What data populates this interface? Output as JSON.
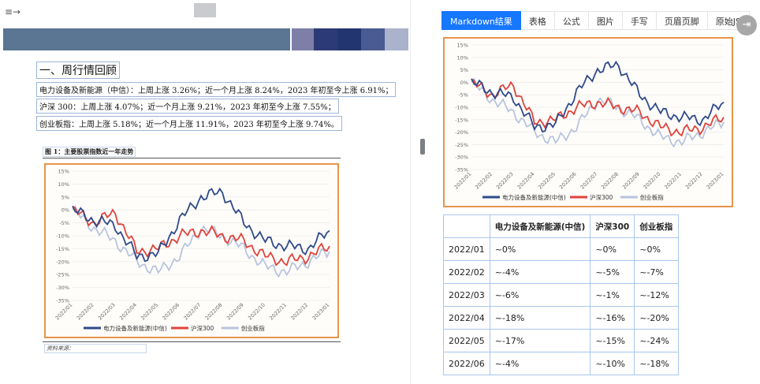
{
  "toolbar": {
    "sidebar_toggle_glyph": "≡→"
  },
  "document": {
    "heading": "一、周行情回顾",
    "lines": [
      "电力设备及新能源（中信）：上周上涨 3.26%；近一个月上涨 8.24%，2023 年初至今上涨 6.91%；",
      "沪深 300：上周上涨 4.07%；近一个月上涨 9.21%，2023 年初至今上涨 7.55%；",
      "创业板指：上周上涨 5.18%；近一个月上涨 11.91%，2023 年初至今上涨 9.74%。"
    ],
    "figure_label": "图 1：主要股票指数近一年走势",
    "source_label": "资料来源："
  },
  "tabs": [
    {
      "label": "Markdown结果",
      "active": true
    },
    {
      "label": "表格",
      "active": false
    },
    {
      "label": "公式",
      "active": false
    },
    {
      "label": "图片",
      "active": false
    },
    {
      "label": "手写",
      "active": false
    },
    {
      "label": "页眉页脚",
      "active": false
    },
    {
      "label": "原始JS",
      "active": false
    }
  ],
  "exit_icon": "exit-icon",
  "chart_data": {
    "type": "line",
    "title": "",
    "xlabel": "",
    "ylabel": "",
    "categories": [
      "2022/01",
      "2022/02",
      "2022/03",
      "2022/04",
      "2022/05",
      "2022/06",
      "2022/07",
      "2022/08",
      "2022/09",
      "2022/10",
      "2022/11",
      "2022/12",
      "2023/01"
    ],
    "ylim": [
      -35,
      15
    ],
    "yticks": [
      "15%",
      "10%",
      "5%",
      "0%",
      "-5%",
      "-10%",
      "-15%",
      "-20%",
      "-25%",
      "-30%",
      "-35%"
    ],
    "legend_position": "bottom",
    "series": [
      {
        "name": "电力设备及新能源(中信)",
        "color": "#2f4a8a",
        "values": [
          0,
          -4,
          -6,
          -18,
          -17,
          -4,
          5,
          7,
          -5,
          -12,
          -14,
          -15,
          -8
        ]
      },
      {
        "name": "沪深300",
        "color": "#e0433b",
        "values": [
          0,
          -5,
          -1,
          -16,
          -15,
          -10,
          -8,
          -10,
          -12,
          -18,
          -20,
          -18,
          -14
        ]
      },
      {
        "name": "创业板指",
        "color": "#b8c4de",
        "values": [
          0,
          -7,
          -12,
          -20,
          -24,
          -18,
          -7,
          -10,
          -15,
          -22,
          -24,
          -20,
          -16
        ]
      }
    ]
  },
  "table": {
    "headers": [
      "",
      "电力设备及新能源(中信)",
      "沪深300",
      "创业板指"
    ],
    "rows": [
      [
        "2022/01",
        "~0%",
        "~0%",
        "~0%"
      ],
      [
        "2022/02",
        "~-4%",
        "~-5%",
        "~-7%"
      ],
      [
        "2022/03",
        "~-6%",
        "~-1%",
        "~-12%"
      ],
      [
        "2022/04",
        "~-18%",
        "~-16%",
        "~-20%"
      ],
      [
        "2022/05",
        "~-17%",
        "~-15%",
        "~-24%"
      ],
      [
        "2022/06",
        "~-4%",
        "~-10%",
        "~-18%"
      ]
    ]
  }
}
